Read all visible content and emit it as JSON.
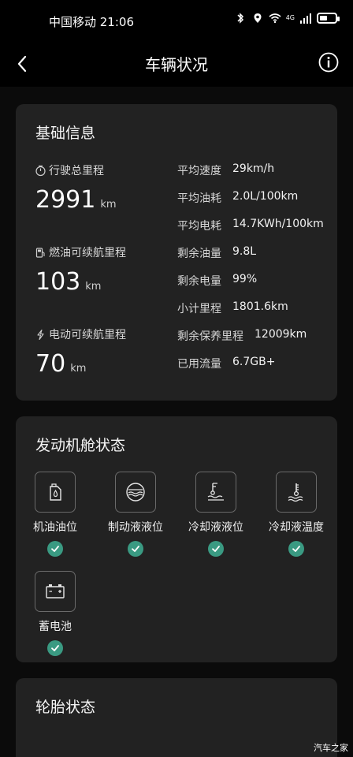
{
  "status_bar": {
    "carrier_time": "中国移动 21:06",
    "network": "4G"
  },
  "nav": {
    "title": "车辆状况"
  },
  "basic_info": {
    "title": "基础信息",
    "total_mileage": {
      "label": "行驶总里程",
      "value": "2991",
      "unit": "km"
    },
    "fuel_range": {
      "label": "燃油可续航里程",
      "value": "103",
      "unit": "km"
    },
    "electric_range": {
      "label": "电动可续航里程",
      "value": "70",
      "unit": "km"
    },
    "stats": [
      {
        "label": "平均速度",
        "value": "29km/h"
      },
      {
        "label": "平均油耗",
        "value": "2.0L/100km"
      },
      {
        "label": "平均电耗",
        "value": "14.7KWh/100km"
      },
      {
        "label": "剩余油量",
        "value": "9.8L"
      },
      {
        "label": "剩余电量",
        "value": "99%"
      },
      {
        "label": "小计里程",
        "value": "1801.6km"
      },
      {
        "label": "剩余保养里程",
        "value": "12009km"
      },
      {
        "label": "已用流量",
        "value": "6.7GB+"
      }
    ]
  },
  "engine_status": {
    "title": "发动机舱状态",
    "items": [
      {
        "label": "机油油位",
        "icon": "oil-level-icon",
        "status": "ok"
      },
      {
        "label": "制动液液位",
        "icon": "brake-fluid-icon",
        "status": "ok"
      },
      {
        "label": "冷却液液位",
        "icon": "coolant-level-icon",
        "status": "ok"
      },
      {
        "label": "冷却液温度",
        "icon": "coolant-temp-icon",
        "status": "ok"
      },
      {
        "label": "蓄电池",
        "icon": "battery-icon",
        "status": "ok"
      }
    ]
  },
  "tire_status": {
    "title": "轮胎状态"
  },
  "watermark": "汽车之家",
  "colors": {
    "background": "#0b0b0b",
    "card": "#222222",
    "check": "#3a9a82"
  }
}
